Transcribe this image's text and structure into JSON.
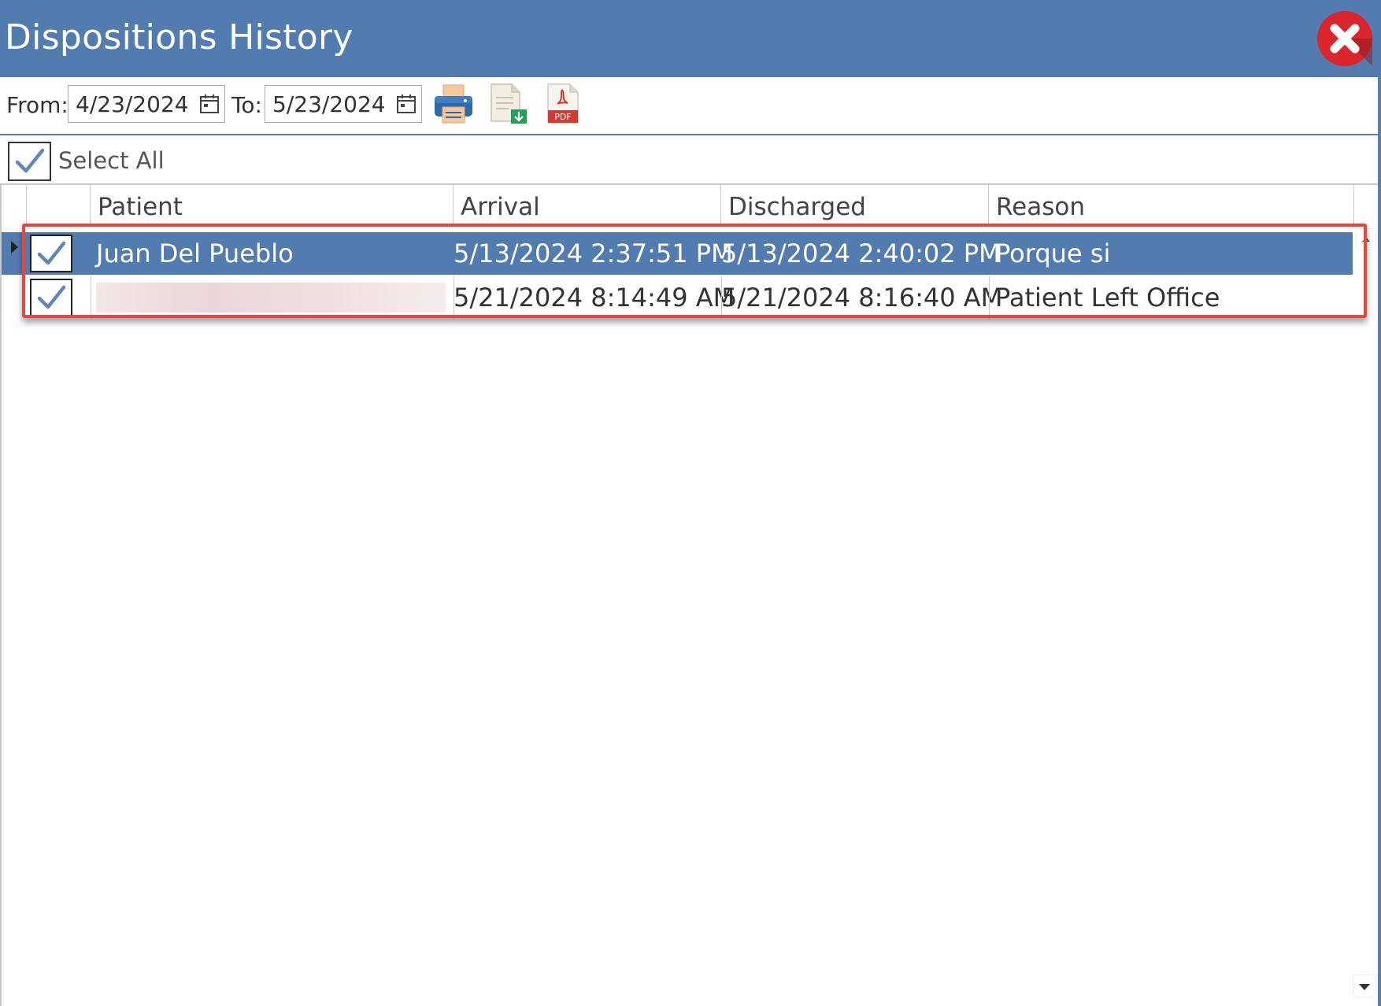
{
  "window": {
    "title": "Dispositions History"
  },
  "toolbar": {
    "from_label": "From:",
    "from_value": "4/23/2024",
    "to_label": "To:",
    "to_value": "5/23/2024",
    "icons": [
      "print-icon",
      "export-document-icon",
      "pdf-icon"
    ],
    "pdf_badge": "PDF"
  },
  "select_all": {
    "label": "Select All",
    "checked": true
  },
  "grid": {
    "columns": [
      "Patient",
      "Arrival",
      "Discharged",
      "Reason"
    ],
    "rows": [
      {
        "checked": true,
        "patient": "Juan Del Pueblo",
        "arrival": "5/13/2024 2:37:51 PM",
        "discharged": "5/13/2024 2:40:02 PM",
        "reason": "Porque si",
        "selected": true
      },
      {
        "checked": true,
        "patient": "",
        "arrival": "5/21/2024 8:14:49 AM",
        "discharged": "5/21/2024 8:16:40 AM",
        "reason": "Patient Left Office",
        "selected": false
      }
    ]
  },
  "colors": {
    "accent": "#527bb0",
    "highlight_border": "#e8453c",
    "close_red": "#d9252b"
  }
}
